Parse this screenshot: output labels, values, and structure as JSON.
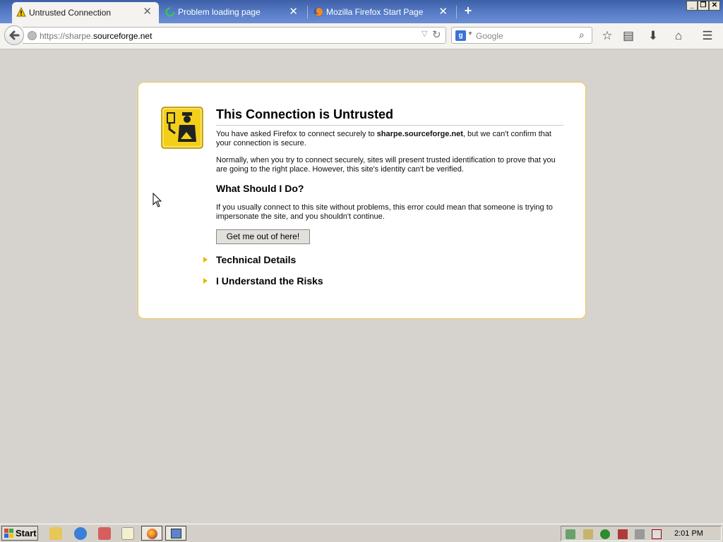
{
  "browser": {
    "tabs": [
      {
        "title": "Untrusted Connection",
        "icon": "warning-icon",
        "active": true
      },
      {
        "title": "Problem loading page",
        "icon": "loading-spinner-icon",
        "active": false
      },
      {
        "title": "Mozilla Firefox Start Page",
        "icon": "firefox-icon",
        "active": false
      }
    ],
    "url": {
      "prefix": "https://sharpe.",
      "host": "sourceforge.net"
    },
    "search": {
      "placeholder": "Google",
      "engine": "google-icon"
    }
  },
  "error_page": {
    "title": "This Connection is Untrusted",
    "para1_a": "You have asked Firefox to connect securely to ",
    "para1_host": "sharpe.sourceforge.net",
    "para1_b": ", but we can't confirm that your connection is secure.",
    "para2": "Normally, when you try to connect securely, sites will present trusted identification to prove that you are going to the right place. However, this site's identity can't be verified.",
    "subtitle": "What Should I Do?",
    "para3": "If you usually connect to this site without problems, this error could mean that someone is trying to impersonate the site, and you shouldn't continue.",
    "button": "Get me out of here!",
    "expander1": "Technical Details",
    "expander2": "I Understand the Risks",
    "accent_color": "#e6b800"
  },
  "taskbar": {
    "start_label": "Start",
    "clock": "2:01 PM"
  }
}
